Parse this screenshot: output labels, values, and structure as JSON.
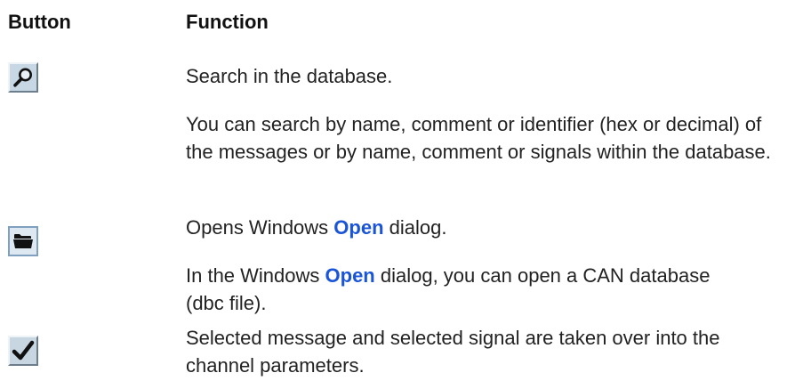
{
  "header": {
    "button": "Button",
    "function": "Function"
  },
  "rows": [
    {
      "icon": "search-icon",
      "paragraphs": [
        "Search in the database.",
        "You can search by name, comment or identifier (hex or decimal) of the messages or by name, comment or signals within the database."
      ]
    },
    {
      "icon": "folder-open-icon",
      "p1_before": "Opens Windows ",
      "p1_link": "Open",
      "p1_after": " dialog.",
      "p2_before": "In the Windows ",
      "p2_link": "Open",
      "p2_after": " dialog, you can open a CAN database (dbc file)."
    },
    {
      "icon": "checkmark-icon",
      "paragraphs": [
        "Selected message and selected signal are taken over into the channel parameters."
      ]
    }
  ],
  "colors": {
    "link": "#1a55d8",
    "button_face": "#c7d7e4"
  }
}
